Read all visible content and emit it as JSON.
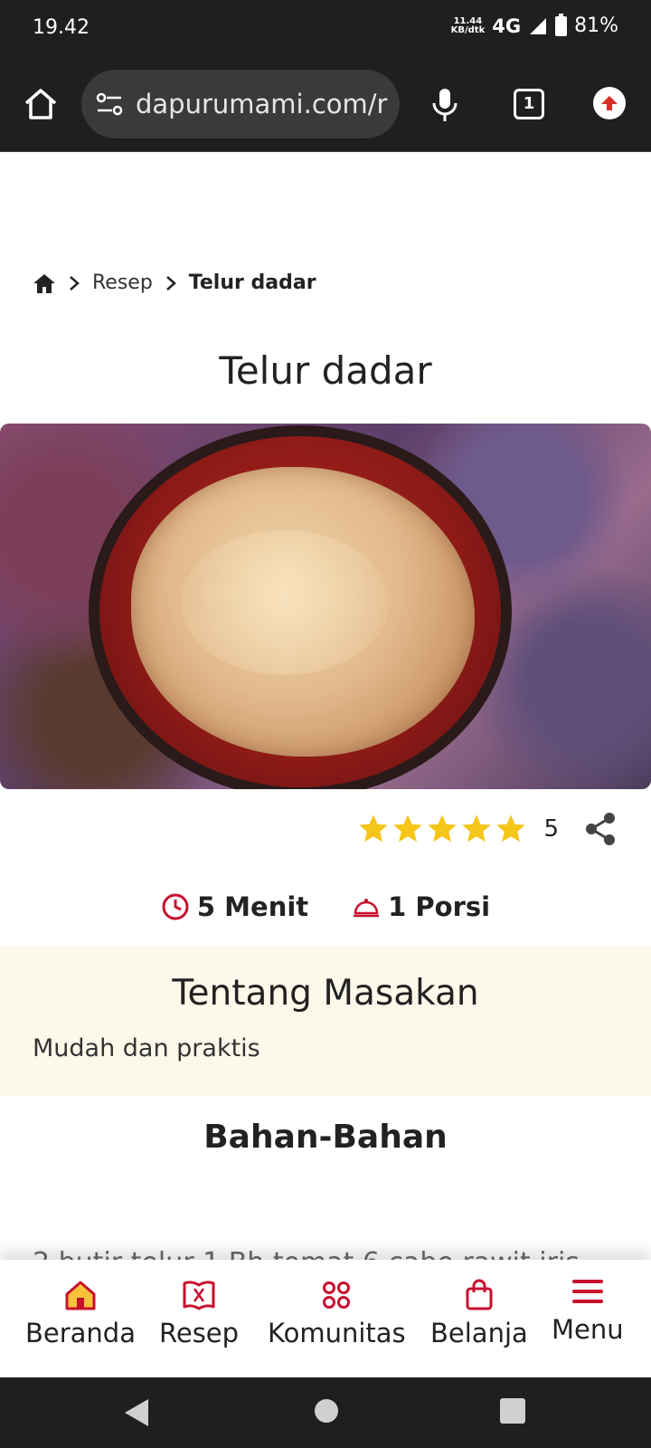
{
  "status_bar": {
    "time": "19.42",
    "net_speed_value": "11.44",
    "net_speed_unit": "KB/dtk",
    "network_type": "4G",
    "battery_percent": "81%"
  },
  "browser": {
    "url": "dapurumami.com/r",
    "tab_count": "1"
  },
  "breadcrumb": {
    "items": [
      "Resep",
      "Telur dadar"
    ]
  },
  "recipe": {
    "title": "Telur dadar",
    "rating": 5,
    "rating_label": "5",
    "cook_time": "5 Menit",
    "servings": "1 Porsi",
    "about_title": "Tentang Masakan",
    "about_text": "Mudah dan praktis",
    "ingredients_title": "Bahan-Bahan",
    "partial_ingredient_text": "2 butir telur 1 Bh tomat 6 cabe rawit iris"
  },
  "bottom_nav": {
    "items": [
      {
        "label": "Beranda",
        "icon": "home-icon"
      },
      {
        "label": "Resep",
        "icon": "recipe-book-icon"
      },
      {
        "label": "Komunitas",
        "icon": "community-icon"
      },
      {
        "label": "Belanja",
        "icon": "shopping-bag-icon"
      },
      {
        "label": "Menu",
        "icon": "hamburger-menu-icon"
      }
    ]
  },
  "colors": {
    "accent": "#c8102e",
    "star": "#f5c518",
    "about_bg": "#fdf9ea",
    "status_bg": "#1f1f1f"
  }
}
